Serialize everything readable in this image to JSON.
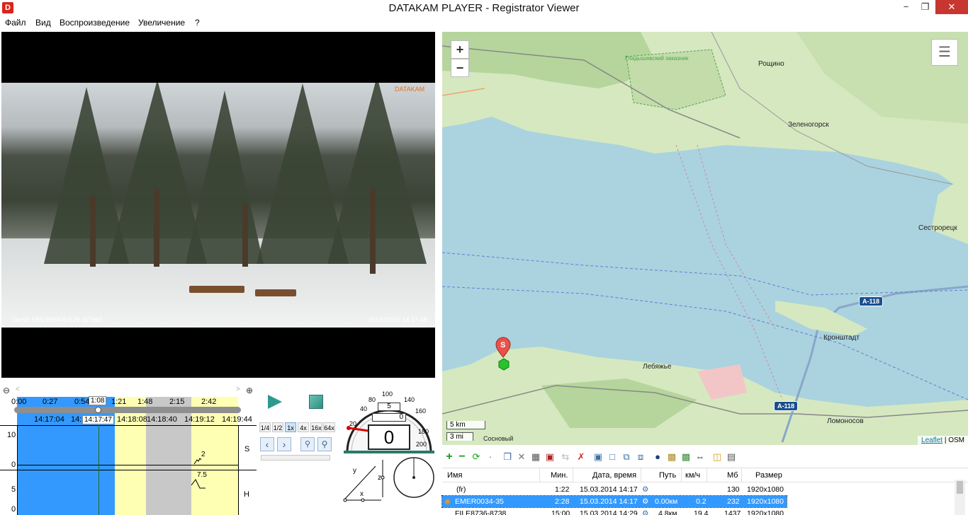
{
  "window": {
    "title": "DATAKAM PLAYER - Registrator Viewer",
    "min_glyph": "−",
    "max_glyph": "❐",
    "close_glyph": "✕"
  },
  "menu": {
    "items": [
      "Файл",
      "Вид",
      "Воспроизведение",
      "Увеличение",
      "?"
    ]
  },
  "video": {
    "osd_left": "0km/h N59.966400 E29.117960",
    "osd_right": "2014/03/15 14:17:48",
    "osd_logo": "DATAKAM"
  },
  "timeline": {
    "top_ticks": [
      "0:00",
      "0:27",
      "0:54",
      "1:08",
      "1:21",
      "1:48",
      "2:15",
      "2:42"
    ],
    "bottom_ticks": [
      "14:17:04",
      "14:1",
      "14:17:47",
      "14:18:08",
      "14:18:40",
      "14:19:12",
      "14:19:44"
    ],
    "graph_s_labels": [
      "10",
      "0"
    ],
    "graph_h_labels": [
      "5",
      "0"
    ],
    "graph_s_name": "S",
    "graph_h_name": "H",
    "s_value": "2",
    "h_value": "7.5",
    "position_fraction": 0.37
  },
  "controls": {
    "speeds": [
      "1/4",
      "1/2",
      "1x",
      "4x",
      "16x",
      "64x"
    ],
    "active_speed": "1x"
  },
  "speedometer": {
    "value": "0",
    "top_value": "5",
    "mid_value": "0",
    "ticks": [
      "20",
      "40",
      "60",
      "80",
      "100",
      "120",
      "140",
      "160",
      "180",
      "200"
    ],
    "axis_labels": [
      "y",
      "z",
      "x"
    ]
  },
  "map": {
    "zoom_in": "+",
    "zoom_out": "−",
    "labels": {
      "roschino": "Рощино",
      "zelenogorsk": "Зеленогорск",
      "sestroretsk": "Сестрорецк",
      "kronshtadt": "Кронштадт",
      "lebyazhye": "Лебяжье",
      "lomonosov": "Ломоносов",
      "sosnovy": "Сосновый",
      "reserve": "Гладышевский заказник"
    },
    "roads": [
      "A-118",
      "A-118"
    ],
    "marker_label": "S",
    "scale_km": "5 km",
    "scale_mi": "3 mi",
    "attribution_link": "Leaflet",
    "attribution_sep": " | ",
    "attribution_text": "OSM"
  },
  "file_list": {
    "columns": [
      "Имя",
      "Мин.",
      "Дата, время",
      "Путь",
      "км/ч",
      "Мб",
      "Размер"
    ],
    "rows": [
      {
        "name": "(fr)",
        "min": "1:22",
        "datetime": "15.03.2014 14:17",
        "path": "",
        "speed": "",
        "mb": "130",
        "size": "1920x1080"
      },
      {
        "name": "EMER0034-35",
        "min": "2:28",
        "datetime": "15.03.2014 14:17",
        "path": "0.00км",
        "speed": "0.2",
        "mb": "232",
        "size": "1920x1080"
      },
      {
        "name": "FILE8736-8738",
        "min": "15:00",
        "datetime": "15.03.2014 14:29",
        "path": "4.8км",
        "speed": "19.4",
        "mb": "1437",
        "size": "1920x1080"
      }
    ],
    "selected_index": 1
  },
  "colors": {
    "timeline_blue": "#3399ff",
    "timeline_yellow": "#ffffb4",
    "timeline_gray": "#c8c8c8",
    "water": "#aad3df",
    "land": "#d6e8c0",
    "forest": "#b5d59c",
    "marker_red": "#e8524a",
    "marker_green": "#25c42a"
  }
}
